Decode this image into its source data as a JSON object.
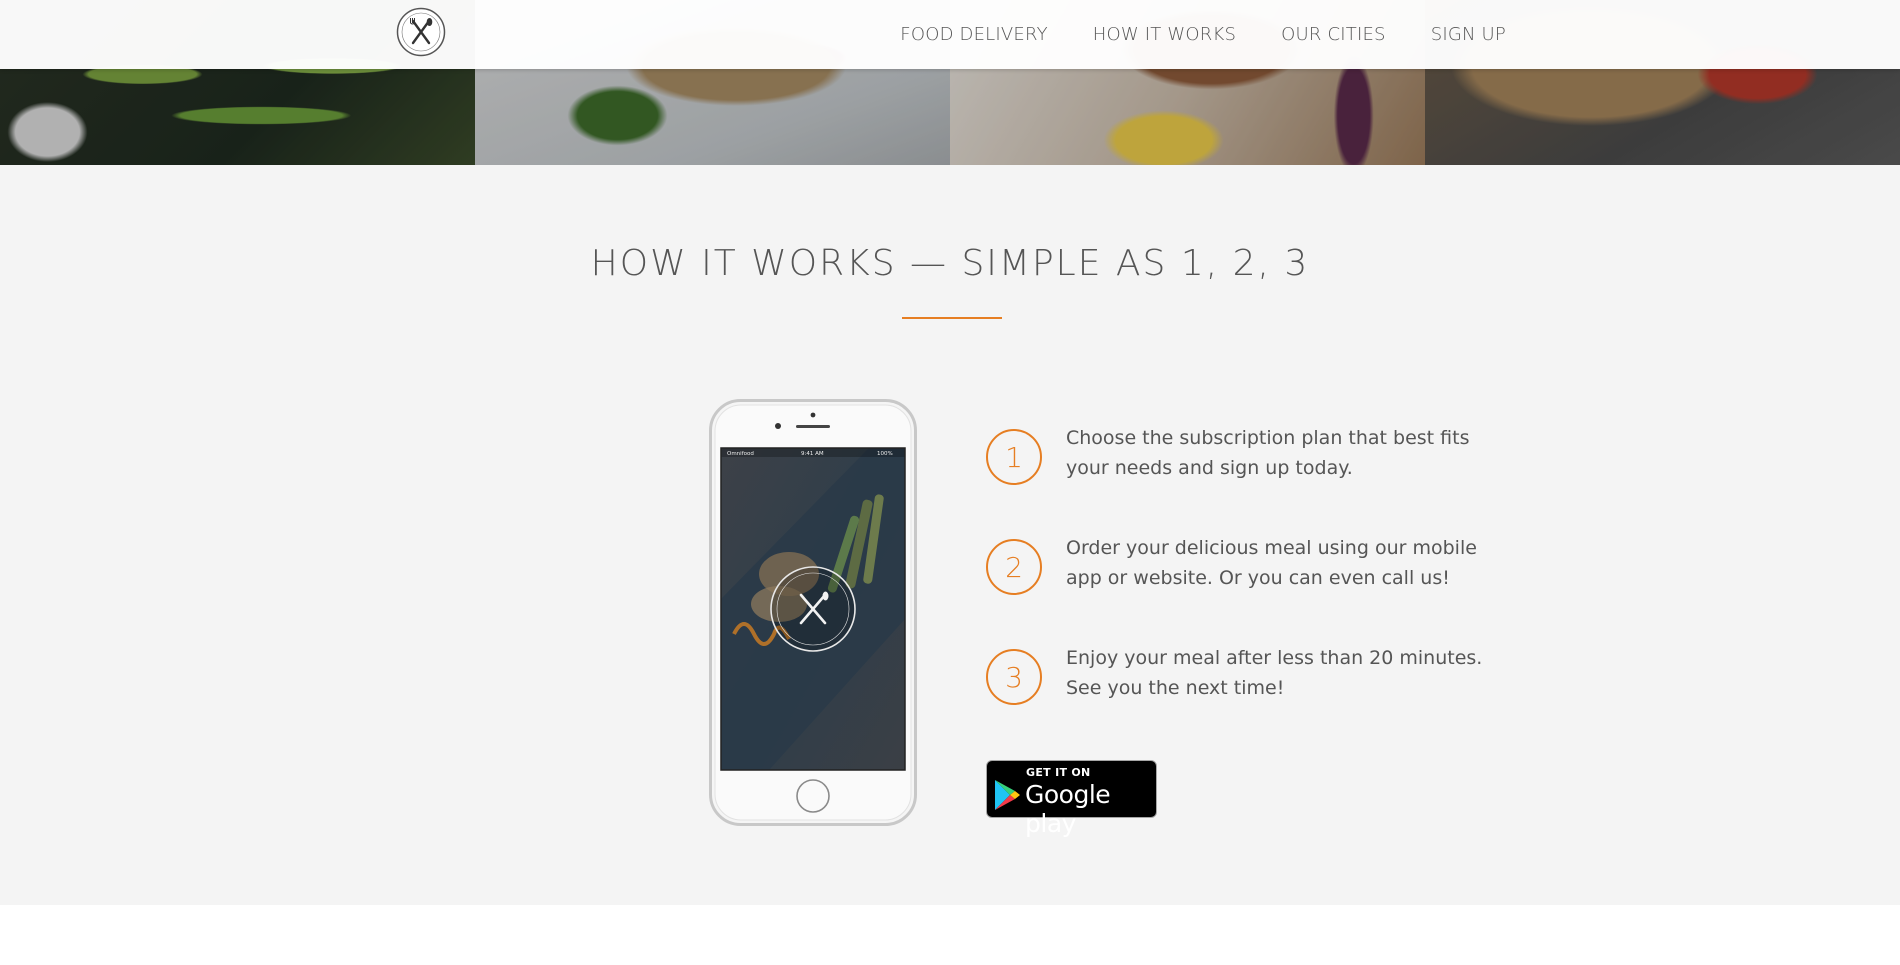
{
  "header": {
    "nav": [
      "FOOD DELIVERY",
      "HOW IT WORKS",
      "OUR CITIES",
      "SIGN UP"
    ]
  },
  "section": {
    "title": "How it works — Simple as 1, 2, 3",
    "steps": [
      {
        "number": "1",
        "text": "Choose the subscription plan that best fits your needs and sign up today."
      },
      {
        "number": "2",
        "text": "Order your delicious meal using our mobile app or website. Or you can even call us!"
      },
      {
        "number": "3",
        "text": "Enjoy your meal after less than 20 minutes. See you the next time!"
      }
    ],
    "store_badge": {
      "small": "GET IT ON",
      "big": "Google play"
    }
  },
  "phone_screen": {
    "carrier": "Omnifood",
    "time": "9:41 AM",
    "battery": "100%"
  },
  "colors": {
    "accent": "#e67e22",
    "section_bg": "#f4f4f4",
    "text": "#555555"
  },
  "icons": [
    "logo-icon",
    "google-play-icon"
  ]
}
